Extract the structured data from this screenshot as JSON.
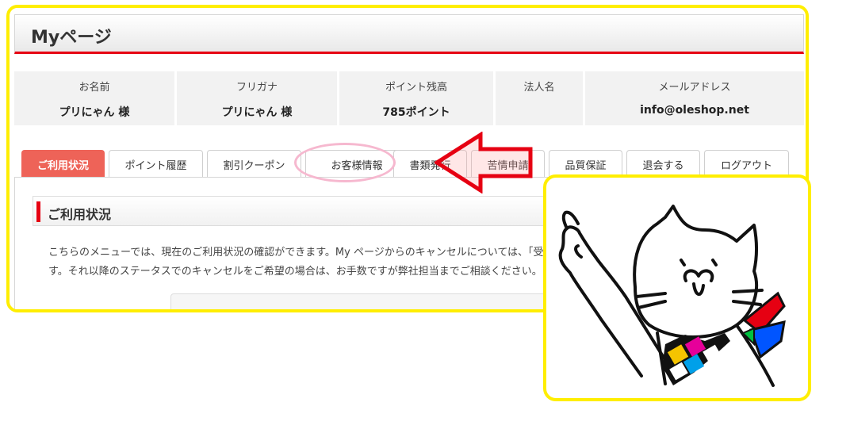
{
  "header": {
    "title": "Myページ"
  },
  "user_info": [
    {
      "label": "お名前",
      "value": "プリにゃん 様"
    },
    {
      "label": "フリガナ",
      "value": "プリにゃん 様"
    },
    {
      "label": "ポイント残高",
      "value": "785ポイント"
    },
    {
      "label": "法人名",
      "value": ""
    },
    {
      "label": "メールアドレス",
      "value": "info@oleshop.net"
    }
  ],
  "tabs": [
    {
      "label": "ご利用状況",
      "active": true
    },
    {
      "label": "ポイント履歴"
    },
    {
      "label": "割引クーポン"
    },
    {
      "label": "お客様情報"
    },
    {
      "label": "書類発行"
    },
    {
      "label": "苦情申請"
    },
    {
      "label": "品質保証"
    },
    {
      "label": "退会する"
    },
    {
      "label": "ログアウト"
    }
  ],
  "section": {
    "title": "ご利用状況",
    "line1": "こちらのメニューでは、現在のご利用状況の確認ができます。My ページからのキャンセルについては、「受",
    "line2": "す。それ以降のステータスでのキャンセルをご希望の場合は、お手数ですが弊社担当までご相談ください。"
  },
  "colors": {
    "accent_red": "#e60012",
    "active_tab": "#ee6358",
    "highlight_yellow": "#ffee00",
    "oval_pink": "#f6b8cf"
  },
  "icons": {
    "arrow": "left-arrow-icon",
    "mascot": "pointing-cat-mascot"
  }
}
